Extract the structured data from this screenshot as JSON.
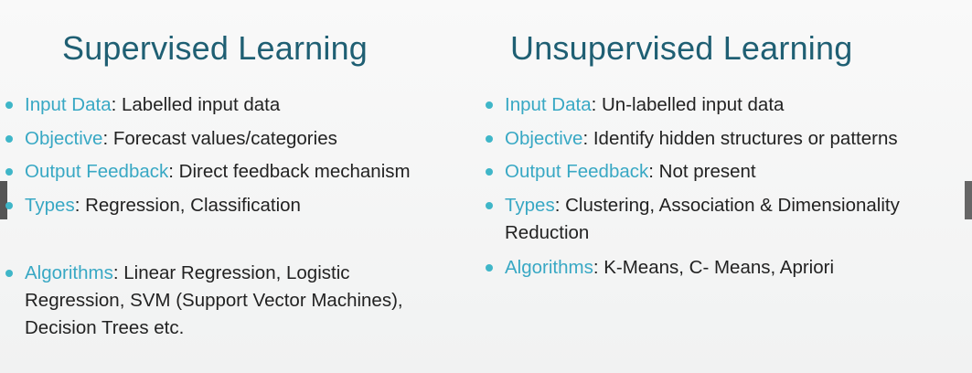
{
  "supervised": {
    "title": "Supervised Learning",
    "items": [
      {
        "key": "Input Data",
        "text": ": Labelled input data"
      },
      {
        "key": "Objective",
        "text": ": Forecast values/categories"
      },
      {
        "key": "Output Feedback",
        "text": ": Direct feedback mechanism"
      },
      {
        "key": "Types",
        "text": ": Regression, Classification"
      },
      {
        "key": "Algorithms",
        "text": ": Linear Regression, Logistic",
        "line2": "Regression, SVM (Support Vector Machines),",
        "line3": "Decision Trees  etc."
      }
    ]
  },
  "unsupervised": {
    "title": "Unsupervised Learning",
    "items": [
      {
        "key": "Input Data",
        "text": ": Un-labelled input data"
      },
      {
        "key": "Objective",
        "text": ": Identify hidden structures or patterns"
      },
      {
        "key": "Output Feedback",
        "text": ": Not present"
      },
      {
        "key": "Types",
        "text": ": Clustering, Association & Dimensionality",
        "line2": "Reduction"
      },
      {
        "key": "Algorithms",
        "text": ": K-Means, C- Means, Apriori"
      }
    ]
  },
  "colors": {
    "heading": "#1f5f73",
    "key": "#38a8c4",
    "bullet": "#3fb6c8",
    "text": "#222222"
  }
}
